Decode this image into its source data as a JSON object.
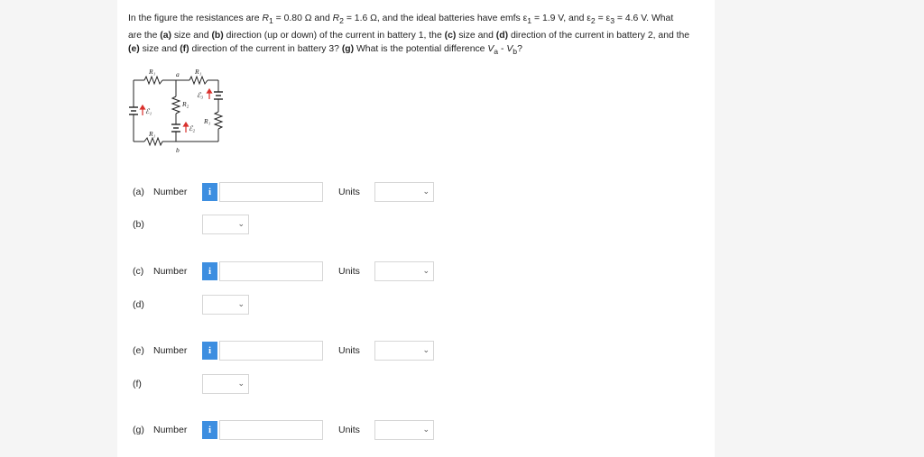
{
  "question": {
    "p1": "In the figure the resistances are ",
    "r1": "R",
    "r1_sub": "1",
    "r1_val": " = 0.80 Ω and ",
    "r2": "R",
    "r2_sub": "2",
    "r2_val": " = 1.6 Ω, and the ideal batteries have emfs ε",
    "e1_sub": "1",
    "e1_val": " = 1.9 V, and ε",
    "e2_sub": "2",
    "e2_eq": " = ε",
    "e3_sub": "3",
    "e3_val": " = 4.6 V. What",
    "line2_a": "are the ",
    "a": "(a)",
    "line2_b": " size and ",
    "b": "(b)",
    "line2_c": " direction (up or down) of the current in battery 1, the ",
    "c": "(c)",
    "line2_d": " size and ",
    "d": "(d)",
    "line2_e": " direction of the current in battery 2, and the",
    "e": "(e)",
    "line3_a": " size and ",
    "f": "(f)",
    "line3_b": " direction of the current in battery 3? ",
    "g": "(g)",
    "line3_c": " What is the potential difference ",
    "va": "V",
    "va_sub": "a",
    "minus": " - ",
    "vb": "V",
    "vb_sub": "b",
    "end": "?"
  },
  "figure": {
    "r1_top_left": "R₁",
    "r1_top_right": "R₁",
    "r1_bottom": "R₁",
    "r1_right": "R₁",
    "r2": "R₂",
    "node_a": "a",
    "node_b": "b",
    "e1": "ℰ₁",
    "e2": "ℰ₂",
    "e3": "ℰ₃"
  },
  "rows": [
    {
      "label": "(a)",
      "number_label": "Number",
      "info": "i",
      "units_label": "Units",
      "value": "",
      "units_value": "",
      "type": "numeric"
    },
    {
      "label": "(b)",
      "type": "direction",
      "value": ""
    },
    {
      "label": "(c)",
      "number_label": "Number",
      "info": "i",
      "units_label": "Units",
      "value": "",
      "units_value": "",
      "type": "numeric"
    },
    {
      "label": "(d)",
      "type": "direction",
      "value": ""
    },
    {
      "label": "(e)",
      "number_label": "Number",
      "info": "i",
      "units_label": "Units",
      "value": "",
      "units_value": "",
      "type": "numeric"
    },
    {
      "label": "(f)",
      "type": "direction",
      "value": ""
    },
    {
      "label": "(g)",
      "number_label": "Number",
      "info": "i",
      "units_label": "Units",
      "value": "",
      "units_value": "",
      "type": "numeric"
    }
  ],
  "colors": {
    "info_button": "#3d8ee0",
    "battery_arrow": "#d9302c"
  }
}
